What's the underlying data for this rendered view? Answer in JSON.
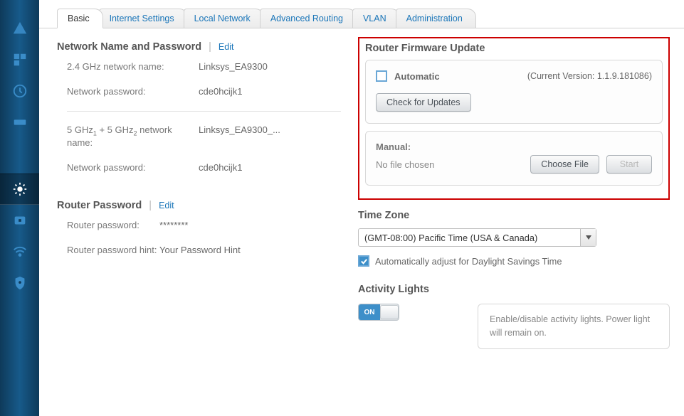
{
  "tabs": [
    "Basic",
    "Internet Settings",
    "Local Network",
    "Advanced Routing",
    "VLAN",
    "Administration"
  ],
  "left": {
    "netpass_title": "Network Name and Password",
    "edit": "Edit",
    "ghz24_label": "2.4 GHz network name:",
    "ghz24_value": "Linksys_EA9300",
    "pw_label": "Network password:",
    "pw_value": "cde0hcijk1",
    "ghz5_label_html": "5 GHz₁ + 5 GHz₂ network name:",
    "ghz5_value": "Linksys_EA9300_...",
    "pw2_value": "cde0hcijk1",
    "router_pw_title": "Router Password",
    "rpw_label": "Router password:",
    "rpw_value": "********",
    "rhint_label": "Router password hint:",
    "rhint_value": "Your Password Hint"
  },
  "firmware": {
    "title": "Router Firmware Update",
    "automatic": "Automatic",
    "version": "(Current Version: 1.1.9.181086)",
    "check_btn": "Check for Updates",
    "manual": "Manual:",
    "nofile": "No file chosen",
    "choose_btn": "Choose File",
    "start_btn": "Start"
  },
  "timezone": {
    "title": "Time Zone",
    "selected": "(GMT-08:00) Pacific Time (USA & Canada)",
    "dst": "Automatically adjust for Daylight Savings Time"
  },
  "activity": {
    "title": "Activity Lights",
    "on": "ON",
    "desc": "Enable/disable activity lights. Power light will remain on."
  }
}
